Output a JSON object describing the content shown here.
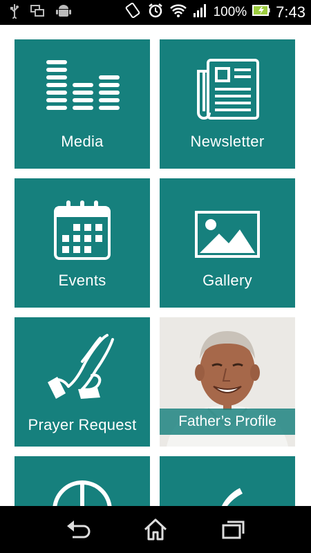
{
  "status_bar": {
    "battery_percent": "100%",
    "time": "7:43",
    "icons": [
      "usb-icon",
      "screen-mirror-icon",
      "android-icon",
      "rotate-icon",
      "alarm-icon",
      "wifi-icon",
      "signal-icon",
      "battery-icon"
    ]
  },
  "tiles": [
    {
      "label": "Media",
      "icon": "media-bars-icon"
    },
    {
      "label": "Newsletter",
      "icon": "newspaper-icon"
    },
    {
      "label": "Events",
      "icon": "calendar-icon"
    },
    {
      "label": "Gallery",
      "icon": "image-icon"
    },
    {
      "label": "Prayer Request",
      "icon": "praying-hands-icon"
    },
    {
      "label": "Father’s Profile",
      "icon": "profile-photo"
    }
  ],
  "colors": {
    "tile_bg": "#16807d",
    "tile_text": "#ffffff",
    "bars": "#000000"
  },
  "nav_bar": {
    "icons": [
      "back-icon",
      "home-icon",
      "recent-apps-icon"
    ]
  }
}
